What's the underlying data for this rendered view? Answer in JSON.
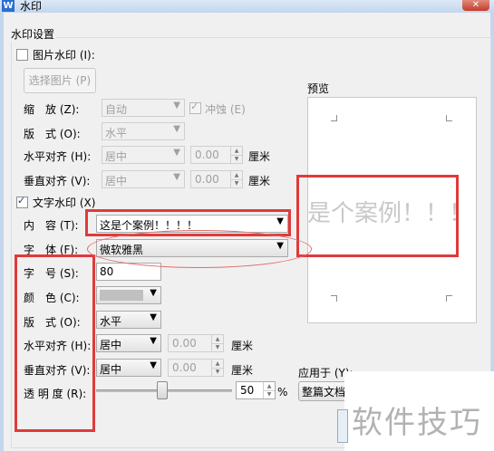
{
  "window": {
    "title": "水印",
    "app_icon_letter": "W",
    "close_glyph": "✕"
  },
  "group": {
    "title": "水印设置"
  },
  "picture": {
    "checkbox_label": "图片水印 (I):",
    "choose_button": "选择图片 (P)",
    "scale_label": "缩　放 (Z):",
    "scale_value": "自动",
    "washout_label": "冲蚀 (E)",
    "layout_label": "版　式 (O):",
    "layout_value": "水平",
    "halign_label": "水平对齐 (H):",
    "halign_value": "居中",
    "halign_offset": "0.00",
    "halign_unit": "厘米",
    "valign_label": "垂直对齐 (V):",
    "valign_value": "居中",
    "valign_offset": "0.00",
    "valign_unit": "厘米"
  },
  "text": {
    "checkbox_label": "文字水印 (X)",
    "content_label": "内　容 (T):",
    "content_value": "这是个案例！！！！",
    "font_label": "字　体 (F):",
    "font_value": "微软雅黑",
    "size_label": "字　号 (S):",
    "size_value": "80",
    "color_label": "颜　色 (C):",
    "color_value": "#c0c0c0",
    "layout_label": "版　式 (O):",
    "layout_value": "水平",
    "halign_label": "水平对齐 (H):",
    "halign_value": "居中",
    "halign_offset": "0.00",
    "halign_unit": "厘米",
    "valign_label": "垂直对齐 (V):",
    "valign_value": "居中",
    "valign_offset": "0.00",
    "valign_unit": "厘米",
    "transparency_label": "透 明 度 (R):",
    "transparency_value": "50",
    "transparency_unit": "%",
    "transparency_level": 0.5
  },
  "preview": {
    "label": "预览",
    "watermark_text": "是个案例！！！"
  },
  "apply": {
    "label": "应用于 (Y):",
    "value": "整篇文档"
  },
  "overlay": {
    "brand": "软件技巧"
  },
  "colors": {
    "annotation_red": "#e03a3a",
    "watermark_gray": "#c0c0c0"
  },
  "icons": {
    "spin_up": "▲",
    "spin_down": "▼",
    "dropdown": "▼"
  }
}
